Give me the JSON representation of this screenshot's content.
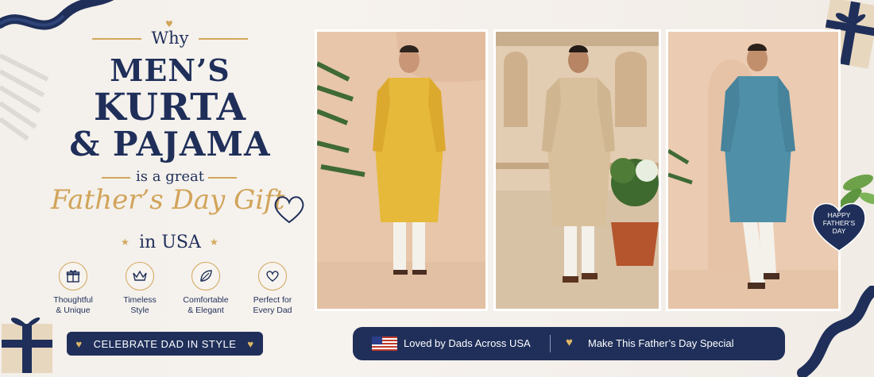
{
  "banner": {
    "why": "Why",
    "line1": "MEN’S",
    "line2": "KURTA",
    "line3": "& PAJAMA",
    "great": "is a great",
    "script": "Father’s Day Gift",
    "usa": "in USA"
  },
  "features": [
    {
      "icon": "gift-icon",
      "label_line1": "Thoughtful",
      "label_line2": "& Unique"
    },
    {
      "icon": "crown-icon",
      "label_line1": "Timeless",
      "label_line2": "Style"
    },
    {
      "icon": "leaf-icon",
      "label_line1": "Comfortable",
      "label_line2": "& Elegant"
    },
    {
      "icon": "heart-icon",
      "label_line1": "Perfect for",
      "label_line2": "Every Dad"
    }
  ],
  "cta": {
    "label": "CELEBRATE DAD IN STYLE"
  },
  "bottom_pill": {
    "text1": "Loved by Dads Across USA",
    "text2": "Make This Father’s Day Special"
  },
  "tag": {
    "line1": "HAPPY",
    "line2": "FATHER’S",
    "line3": "DAY"
  },
  "colors": {
    "navy": "#1f2f5a",
    "gold": "#d1a75b",
    "kurta_yellow": "#e6b93a",
    "kurta_beige": "#d9c09c",
    "kurta_blue": "#4f8fa8"
  }
}
